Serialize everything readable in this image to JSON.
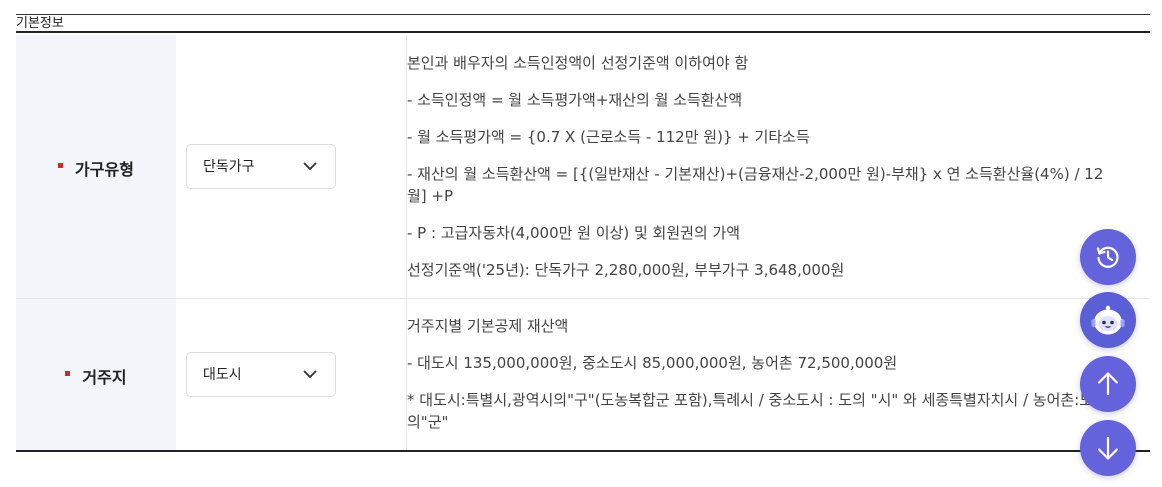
{
  "caption": "기본정보",
  "rows": [
    {
      "label": "가구유형",
      "select_value": "단독가구",
      "description": [
        "본인과 배우자의 소득인정액이 선정기준액 이하여야 함",
        "- 소득인정액 = 월 소득평가액+재산의 월 소득환산액",
        "- 월 소득평가액 = {0.7 X (근로소득 - 112만 원)} + 기타소득",
        "- 재산의 월 소득환산액 = [{(일반재산 - 기본재산)+(금융재산-2,000만 원)-부채} x 연 소득환산율(4%) / 12월] +P",
        "- P : 고급자동차(4,000만 원 이상) 및 회원권의 가액",
        "선정기준액('25년): 단독가구 2,280,000원, 부부가구 3,648,000원"
      ]
    },
    {
      "label": "거주지",
      "select_value": "대도시",
      "description": [
        "거주지별 기본공제 재산액",
        "- 대도시 135,000,000원, 중소도시 85,000,000원, 농어촌 72,500,000원",
        "* 대도시:특별시,광역시의\"구\"(도농복합군 포함),특례시 / 중소도시 : 도의 \"시\" 와 세종특별자치시 / 농어촌:도의\"군\""
      ]
    }
  ],
  "floating_buttons": [
    "history-icon",
    "chatbot-icon",
    "arrow-up-icon",
    "arrow-down-icon"
  ],
  "colors": {
    "accent": "#6463dc",
    "marker": "#d6282b",
    "header_bg": "#f4f5fb"
  }
}
